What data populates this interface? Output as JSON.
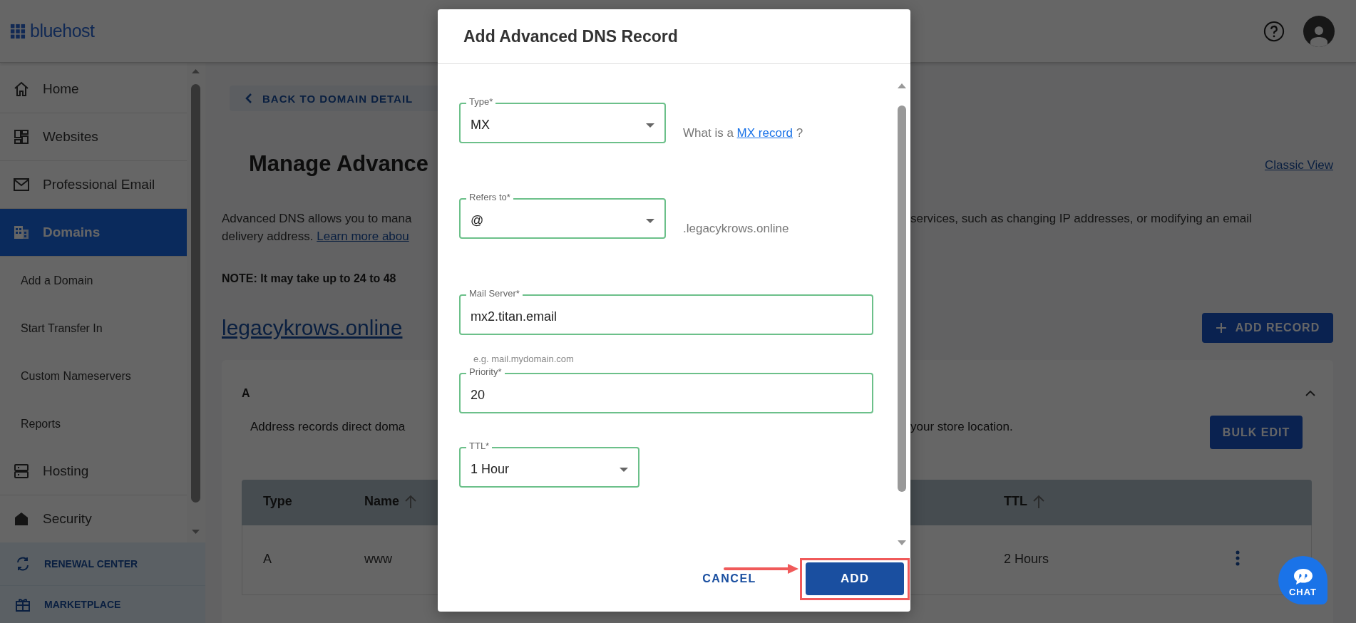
{
  "header": {
    "logo": "bluehost"
  },
  "sidebar": {
    "items": [
      {
        "label": "Home",
        "selected": false
      },
      {
        "label": "Websites",
        "selected": false
      },
      {
        "label": "Professional Email",
        "selected": false
      },
      {
        "label": "Domains",
        "selected": true,
        "children": [
          {
            "label": "Add a Domain",
            "selected": false
          },
          {
            "label": "Start Transfer In",
            "selected": false
          },
          {
            "label": "Custom Nameservers",
            "selected": false
          },
          {
            "label": "Reports",
            "selected": false
          }
        ]
      },
      {
        "label": "Hosting",
        "selected": false
      },
      {
        "label": "Security",
        "selected": false
      }
    ],
    "footer_links": [
      "RENEWAL CENTER",
      "MARKETPLACE"
    ]
  },
  "page": {
    "back_button": "BACK TO DOMAIN DETAIL",
    "title": "Manage Advance",
    "classic_view_link": "Classic View",
    "description": {
      "left_lines": [
        {
          "text": "Advanced DNS allows you to mana"
        },
        {
          "text": "delivery address. ",
          "link": "Learn more abou"
        }
      ],
      "right_line": "services, such as changing IP addresses, or modifying an email"
    },
    "note": "NOTE: It may take up to 24 to 48",
    "domain_link": "legacykrows.online",
    "add_record_button": "ADD RECORD"
  },
  "record_card": {
    "heading": "A",
    "expanded": true,
    "description_left": "Address records direct doma",
    "description_right": "your store location.",
    "bulk_edit_button": "BULK EDIT",
    "table": {
      "columns": [
        {
          "label": "Type",
          "sort_arrow": false
        },
        {
          "label": "Name",
          "sort_arrow": true
        },
        {
          "label": "TTL",
          "sort_arrow": true
        }
      ],
      "rows": [
        {
          "type": "A",
          "name": "www",
          "ttl": "2 Hours"
        }
      ]
    }
  },
  "modal": {
    "title": "Add Advanced DNS Record",
    "fields": [
      {
        "kind": "select",
        "label": "Type*",
        "value": "MX",
        "aside": {
          "prefix": "What is a ",
          "link": "MX record",
          "suffix": " ?"
        }
      },
      {
        "kind": "select",
        "label": "Refers to*",
        "value": "@",
        "aside": {
          "prefix": ".legacykrows.online"
        }
      },
      {
        "kind": "text",
        "label": "Mail Server*",
        "value": "mx2.titan.email",
        "helper": "e.g. mail.mydomain.com"
      },
      {
        "kind": "text",
        "label": "Priority*",
        "value": "20"
      },
      {
        "kind": "select",
        "label": "TTL*",
        "value": "1 Hour"
      }
    ],
    "cancel_button": "CANCEL",
    "add_button": "ADD"
  },
  "chat_button": "CHAT"
}
